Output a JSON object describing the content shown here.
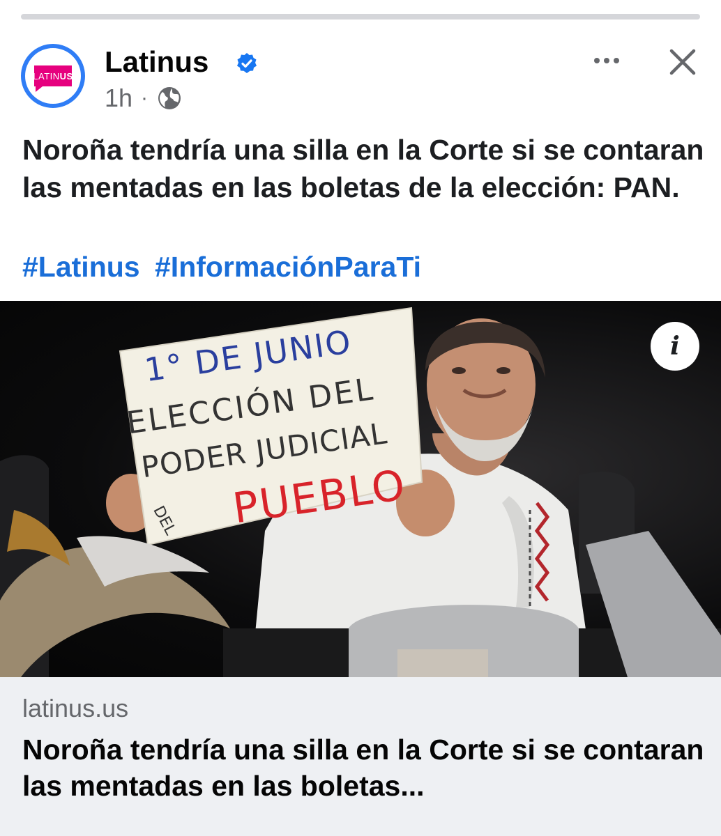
{
  "post": {
    "page_name": "Latinus",
    "avatar_text_light": "LATIN",
    "avatar_text_bold": "US",
    "time": "1h",
    "separator": "·",
    "audience_icon": "globe-icon",
    "verified_icon": "verified-badge-icon",
    "more_icon": "more-options-icon",
    "close_icon": "close-icon",
    "text": "Noroña tendría una silla en la Corte si se contaran las mentadas en las boletas de la elección: PAN.",
    "hashtags": [
      "#Latinus",
      "#InformaciónParaTi"
    ]
  },
  "photo": {
    "sign_line1": "1° DE JUNIO",
    "sign_line2": "ELECCIÓN DEL",
    "sign_line3": "PODER JUDICIAL",
    "sign_del": "DEL",
    "sign_line4": "PUEBLO",
    "info_label": "i"
  },
  "link": {
    "domain": "latinus.us",
    "title": "Noroña tendría una silla en la Corte si se contaran las mentadas en las boletas..."
  },
  "colors": {
    "accent_blue": "#1a6ed8",
    "verified_blue": "#1877f2",
    "brand_pink": "#e6007e",
    "sign_blue": "#2a3f9e",
    "sign_red": "#d8232a"
  }
}
